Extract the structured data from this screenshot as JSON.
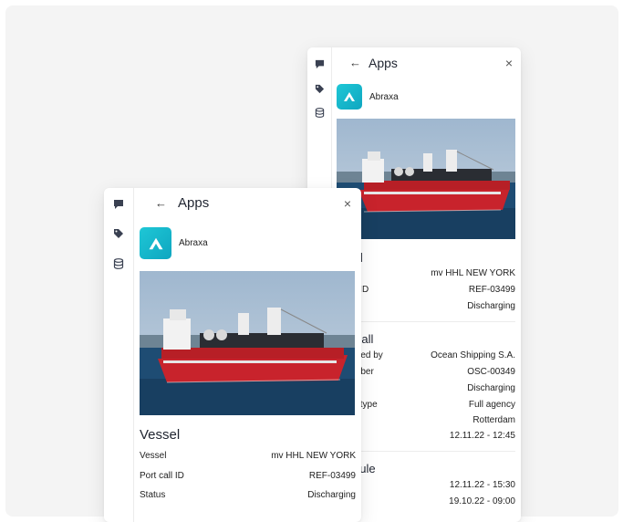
{
  "app_panel": {
    "title": "Apps",
    "back_icon": "arrow-left-icon",
    "close_icon": "close-icon",
    "rail_icons": [
      "chat-icon",
      "tag-icon",
      "database-icon"
    ]
  },
  "app": {
    "name": "Abraxa",
    "logo_icon": "abraxa-logo",
    "brand_color": "#17b8cc"
  },
  "vessel_section": {
    "title": "Vessel",
    "rows": [
      {
        "label": "Vessel",
        "value": "mv HHL NEW YORK"
      },
      {
        "label": "Port call ID",
        "value": "REF-03499"
      },
      {
        "label": "Status",
        "value": "Discharging"
      }
    ]
  },
  "back_panel": {
    "vessel_title_fragment": "el",
    "vessel_rows": [
      {
        "label": "",
        "value": "mv HHL NEW YORK"
      },
      {
        "label": "ll ID",
        "value": "REF-03499"
      },
      {
        "label": "",
        "value": "Discharging"
      }
    ],
    "call_title_fragment": "Call",
    "call_rows": [
      {
        "label": "ated by",
        "value": "Ocean Shipping S.A."
      },
      {
        "label": "mber",
        "value": "OSC-00349"
      },
      {
        "label": "n",
        "value": "Discharging"
      },
      {
        "label": "y type",
        "value": "Full agency"
      },
      {
        "label": "",
        "value": "Rotterdam"
      },
      {
        "label": "",
        "value": "12.11.22 - 12:45"
      }
    ],
    "schedule_title_fragment": "dule",
    "schedule_rows": [
      {
        "label": "",
        "value": "12.11.22 - 15:30"
      },
      {
        "label": "",
        "value": "19.10.22 - 09:00"
      }
    ]
  }
}
